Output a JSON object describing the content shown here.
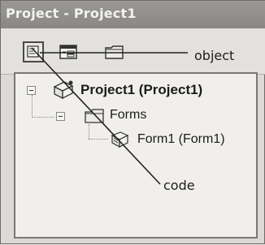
{
  "window": {
    "title": "Project - Project1"
  },
  "toolbar": {
    "buttons": [
      {
        "name": "view-code",
        "icon": "view-code-icon",
        "pressed": true
      },
      {
        "name": "view-object",
        "icon": "view-object-icon",
        "pressed": false
      },
      {
        "name": "toggle-folders",
        "icon": "folder-icon",
        "pressed": false
      }
    ]
  },
  "annotations": {
    "object_label": "object",
    "code_label": "code"
  },
  "tree": {
    "project": {
      "label": "Project1 (Project1)",
      "icon": "project-icon",
      "expanded": true
    },
    "forms_folder": {
      "label": "Forms",
      "icon": "folder-icon",
      "expanded": true
    },
    "form1": {
      "label": "Form1 (Form1)",
      "icon": "form-icon"
    }
  },
  "colors": {
    "titlebar": "#8e8c88",
    "window_bg": "#dcdad6",
    "tree_bg": "#f0efec"
  }
}
